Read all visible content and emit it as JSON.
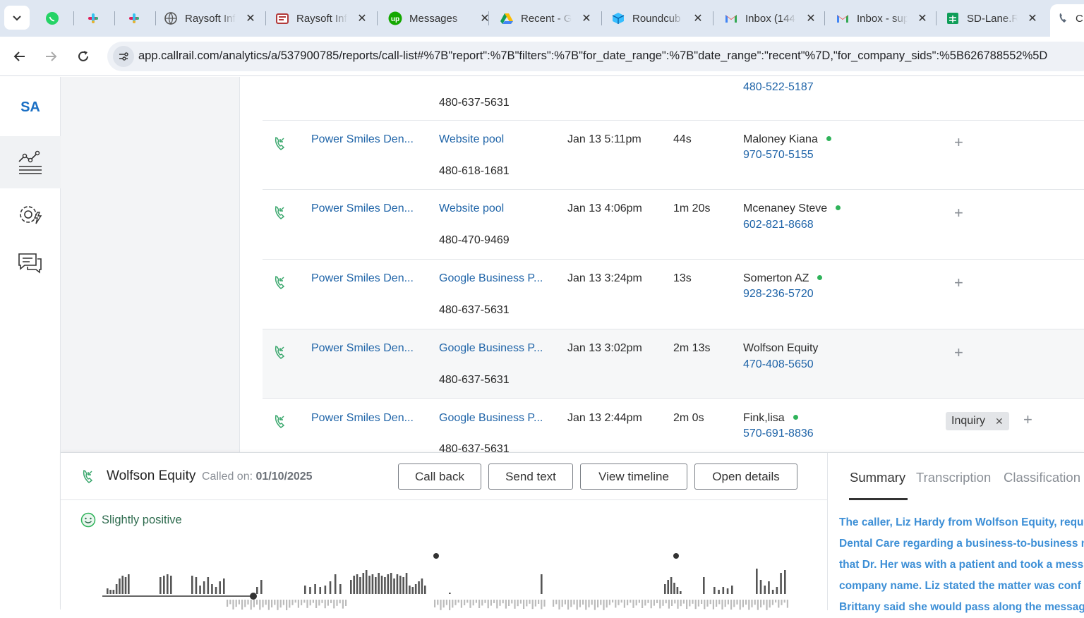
{
  "browser": {
    "tabs": [
      {
        "label": "",
        "icon": "whatsapp-icon"
      },
      {
        "label": "",
        "icon": "slack-icon"
      },
      {
        "label": "",
        "icon": "slack-icon"
      },
      {
        "label": "Raysoft Inf",
        "icon": "globe-icon"
      },
      {
        "label": "Raysoft Inf",
        "icon": "raysoft-icon"
      },
      {
        "label": "Messages",
        "icon": "upwork-icon"
      },
      {
        "label": "Recent - G",
        "icon": "google-drive-icon"
      },
      {
        "label": "Roundcub",
        "icon": "roundcube-icon"
      },
      {
        "label": "Inbox (144",
        "icon": "gmail-icon"
      },
      {
        "label": "Inbox - sup",
        "icon": "gmail-icon"
      },
      {
        "label": "SD-Lane.R",
        "icon": "google-sheets-icon"
      },
      {
        "label": "C",
        "icon": "callrail-icon"
      }
    ],
    "url": "app.callrail.com/analytics/a/537900785/reports/call-list#%7B\"report\":%7B\"filters\":%7B\"for_date_range\":%7B\"date_range\":\"recent\"%7D,\"for_company_sids\":%5B626788552%5D"
  },
  "sidebar": {
    "logo": "SA",
    "items": [
      {
        "name": "analytics",
        "icon": "analytics-chart-icon"
      },
      {
        "name": "settings",
        "icon": "settings-gear-icon"
      },
      {
        "name": "messages",
        "icon": "chat-bubbles-icon"
      }
    ]
  },
  "calls": {
    "partial_row": {
      "tracking_number": "480-637-5631",
      "caller_phone": "480-522-5187"
    },
    "rows": [
      {
        "company": "Power Smiles Den...",
        "source": "Website pool",
        "tracking_number": "480-618-1681",
        "datetime": "Jan 13 5:11pm",
        "duration": "44s",
        "caller_name": "Maloney Kiana",
        "caller_phone": "970-570-5155",
        "online": true,
        "tags": []
      },
      {
        "company": "Power Smiles Den...",
        "source": "Website pool",
        "tracking_number": "480-470-9469",
        "datetime": "Jan 13 4:06pm",
        "duration": "1m 20s",
        "caller_name": "Mcenaney Steve",
        "caller_phone": "602-821-8668",
        "online": true,
        "tags": []
      },
      {
        "company": "Power Smiles Den...",
        "source": "Google Business P...",
        "tracking_number": "480-637-5631",
        "datetime": "Jan 13 3:24pm",
        "duration": "13s",
        "caller_name": "Somerton AZ",
        "caller_phone": "928-236-5720",
        "online": true,
        "tags": []
      },
      {
        "company": "Power Smiles Den...",
        "source": "Google Business P...",
        "tracking_number": "480-637-5631",
        "datetime": "Jan 13 3:02pm",
        "duration": "2m 13s",
        "caller_name": "Wolfson Equity",
        "caller_phone": "470-408-5650",
        "online": false,
        "tags": []
      },
      {
        "company": "Power Smiles Den...",
        "source": "Google Business P...",
        "tracking_number": "480-637-5631",
        "datetime": "Jan 13 2:44pm",
        "duration": "2m 0s",
        "caller_name": "Fink,lisa",
        "caller_phone": "570-691-8836",
        "online": true,
        "tags": [
          "Inquiry"
        ]
      }
    ]
  },
  "panel": {
    "caller_name": "Wolfson Equity",
    "called_on_label": "Called on:",
    "called_on_date": "01/10/2025",
    "buttons": {
      "call_back": "Call back",
      "send_text": "Send text",
      "view_timeline": "View timeline",
      "open_details": "Open details"
    },
    "sentiment": "Slightly positive",
    "tabs": {
      "summary": "Summary",
      "transcription": "Transcription",
      "classification": "Classification"
    },
    "summary_lines": [
      "The caller, Liz Hardy from Wolfson Equity, requ",
      "Dental Care regarding a business-to-business m",
      "that Dr. Her was with a patient and took a mess",
      "company name. Liz stated the matter was conf",
      "Brittany said she would pass along the messag"
    ]
  },
  "colors": {
    "link": "#1f64a8",
    "online": "#2fb35a",
    "summary": "#3d8fd6",
    "sentiment": "#2e6b4e",
    "call_icon": "#3aa76d"
  }
}
